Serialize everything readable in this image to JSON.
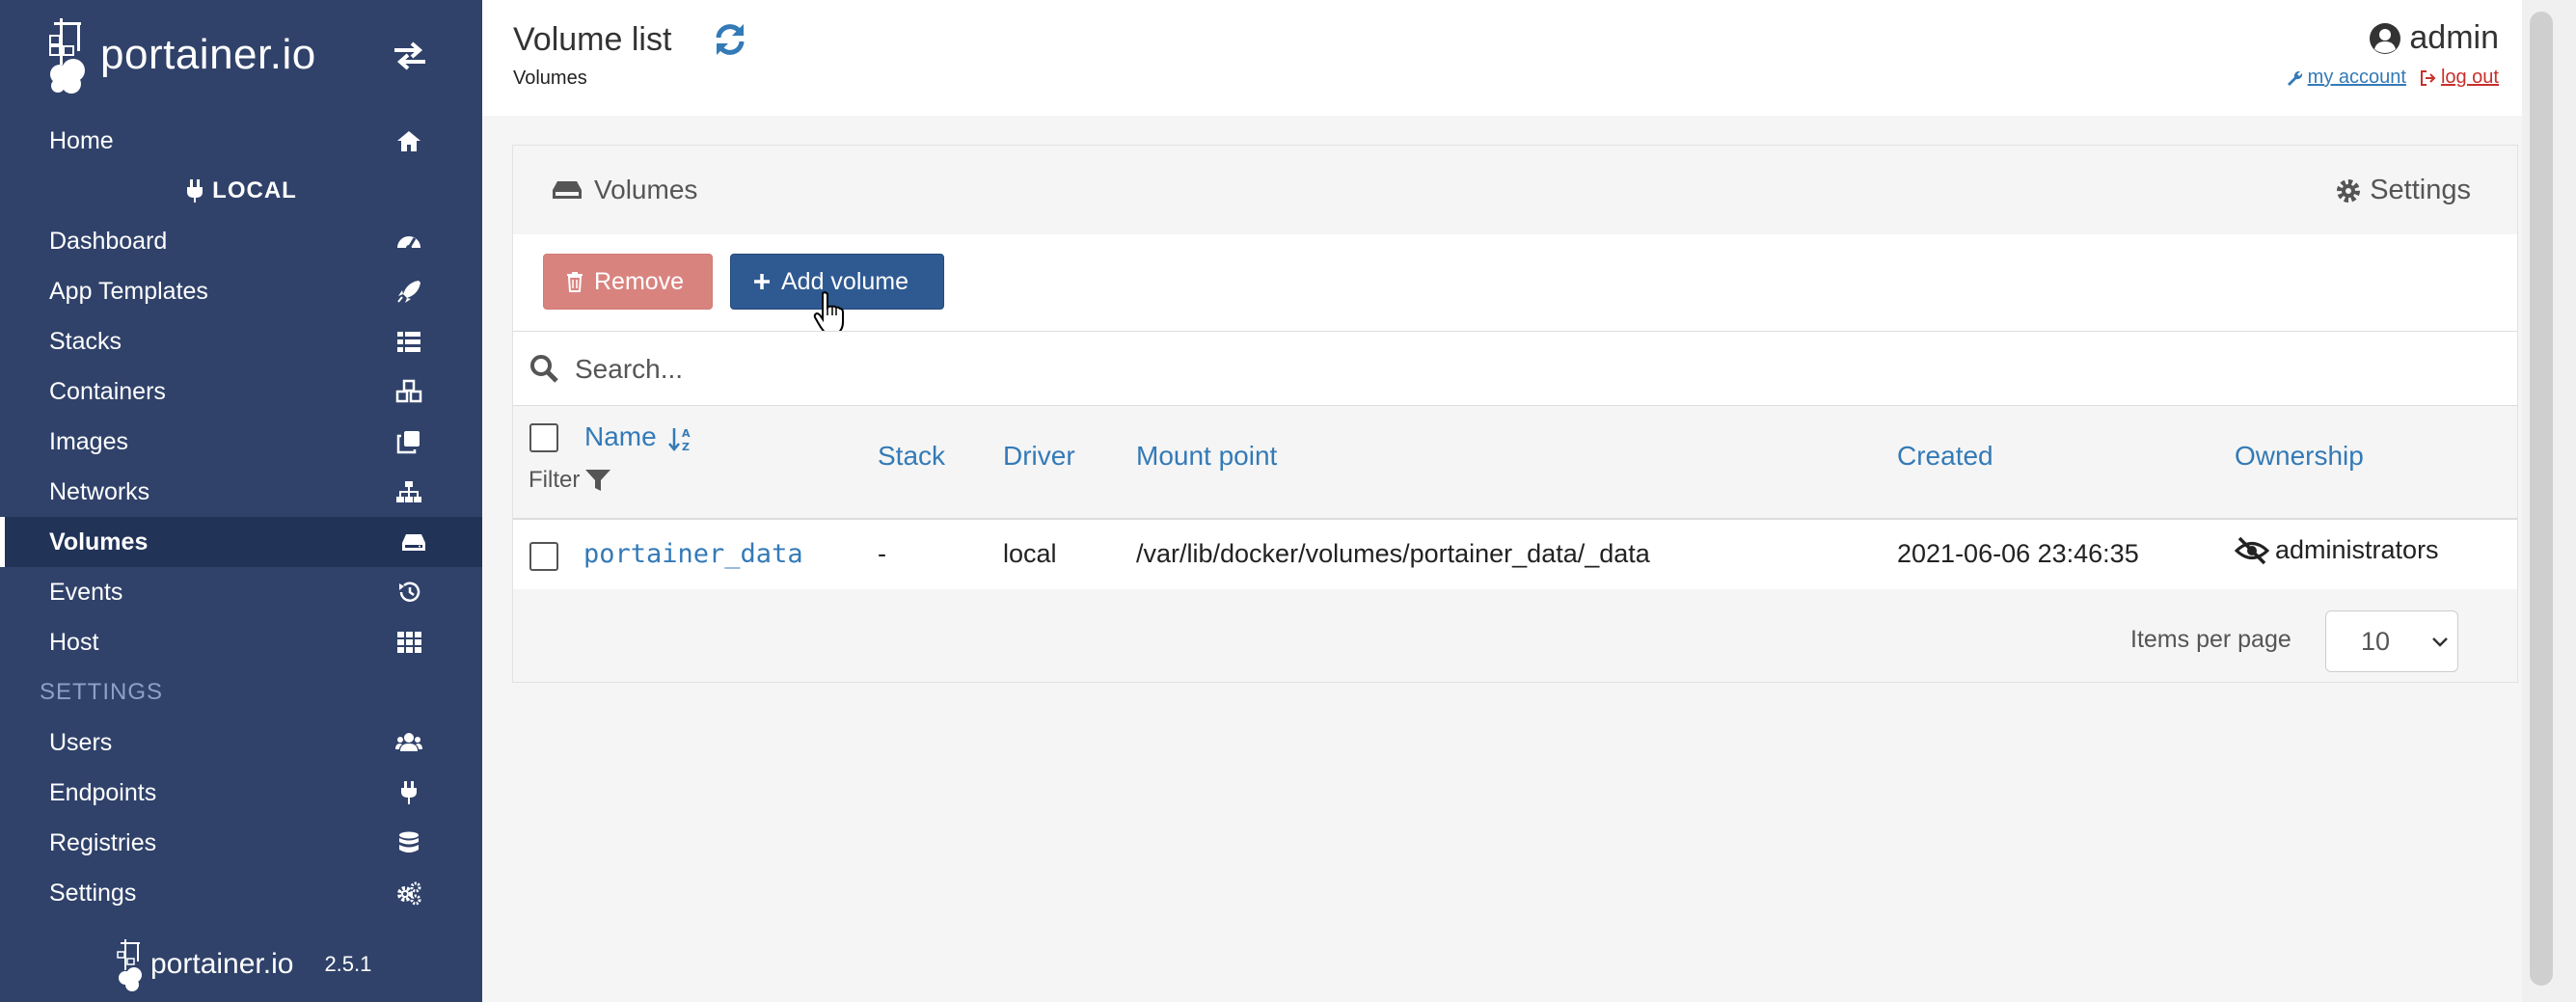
{
  "sidebar": {
    "brand": "portainer.io",
    "nav_home": "Home",
    "endpoint_label": "LOCAL",
    "items": [
      {
        "label": "Dashboard",
        "icon": "dashboard-icon"
      },
      {
        "label": "App Templates",
        "icon": "rocket-icon"
      },
      {
        "label": "Stacks",
        "icon": "list-icon"
      },
      {
        "label": "Containers",
        "icon": "cubes-icon"
      },
      {
        "label": "Images",
        "icon": "clone-icon"
      },
      {
        "label": "Networks",
        "icon": "sitemap-icon"
      },
      {
        "label": "Volumes",
        "icon": "hdd-icon",
        "active": true
      },
      {
        "label": "Events",
        "icon": "history-icon"
      },
      {
        "label": "Host",
        "icon": "th-icon"
      }
    ],
    "settings_section": "SETTINGS",
    "settings_items": [
      {
        "label": "Users",
        "icon": "users-icon"
      },
      {
        "label": "Endpoints",
        "icon": "plug-icon"
      },
      {
        "label": "Registries",
        "icon": "database-icon"
      },
      {
        "label": "Settings",
        "icon": "cogs-icon"
      }
    ],
    "footer_brand": "portainer.io",
    "version": "2.5.1"
  },
  "header": {
    "title": "Volume list",
    "breadcrumb": "Volumes",
    "username": "admin",
    "my_account": "my account",
    "log_out": "log out"
  },
  "widget": {
    "title": "Volumes",
    "settings_label": "Settings",
    "remove_label": "Remove",
    "add_label": "Add volume",
    "search_placeholder": "Search...",
    "columns": {
      "name": "Name",
      "filter": "Filter",
      "stack": "Stack",
      "driver": "Driver",
      "mount_point": "Mount point",
      "created": "Created",
      "ownership": "Ownership"
    },
    "rows": [
      {
        "name": "portainer_data",
        "stack": "-",
        "driver": "local",
        "mount_point": "/var/lib/docker/volumes/portainer_data/_data",
        "created": "2021-06-06 23:46:35",
        "ownership": "administrators"
      }
    ],
    "items_per_page_label": "Items per page",
    "items_per_page_value": "10"
  },
  "colors": {
    "sidebar_bg": "#30426a",
    "sidebar_active": "#223358",
    "link": "#337ab7",
    "remove_btn": "#d9837f",
    "add_btn": "#2f5a91"
  }
}
